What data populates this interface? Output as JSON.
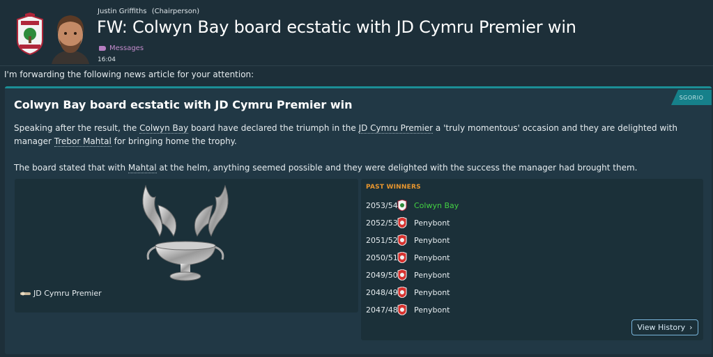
{
  "header": {
    "sender_name": "Justin Griffiths",
    "sender_role": "(Chairperson)",
    "subject": "FW: Colwyn Bay board ecstatic with JD Cymru Premier win",
    "folder": "Messages",
    "time": "16:04"
  },
  "forward_text": "I'm forwarding the following news article for your attention:",
  "article": {
    "source": "SGORIO",
    "title": "Colwyn Bay board ecstatic with JD Cymru Premier win",
    "p1_a": "Speaking after the result, the ",
    "p1_club": "Colwyn Bay",
    "p1_b": " board have declared the triumph in the ",
    "p1_comp": "JD Cymru Premier",
    "p1_c": " a 'truly momentous' occasion and they are delighted with manager ",
    "p1_manager": "Trebor Mahtal",
    "p1_d": " for bringing home the trophy.",
    "p2_a": "The board stated that with ",
    "p2_manager": "Mahtal",
    "p2_b": " at the helm, anything seemed possible and they were delighted with the success the manager had brought them."
  },
  "competition": {
    "name": "JD Cymru Premier"
  },
  "past_winners": {
    "title": "PAST WINNERS",
    "rows": [
      {
        "season": "2053/54",
        "club": "Colwyn Bay"
      },
      {
        "season": "2052/53",
        "club": "Penybont"
      },
      {
        "season": "2051/52",
        "club": "Penybont"
      },
      {
        "season": "2050/51",
        "club": "Penybont"
      },
      {
        "season": "2049/50",
        "club": "Penybont"
      },
      {
        "season": "2048/49",
        "club": "Penybont"
      },
      {
        "season": "2047/48",
        "club": "Penybont"
      }
    ],
    "view_history": "View History"
  },
  "colors": {
    "background": "#1d2f39",
    "card": "#213845",
    "accent_teal": "#1b8f96",
    "past_winners_orange": "#e8962e",
    "highlight_green": "#43d043",
    "folder_purple": "#c48ccd"
  }
}
